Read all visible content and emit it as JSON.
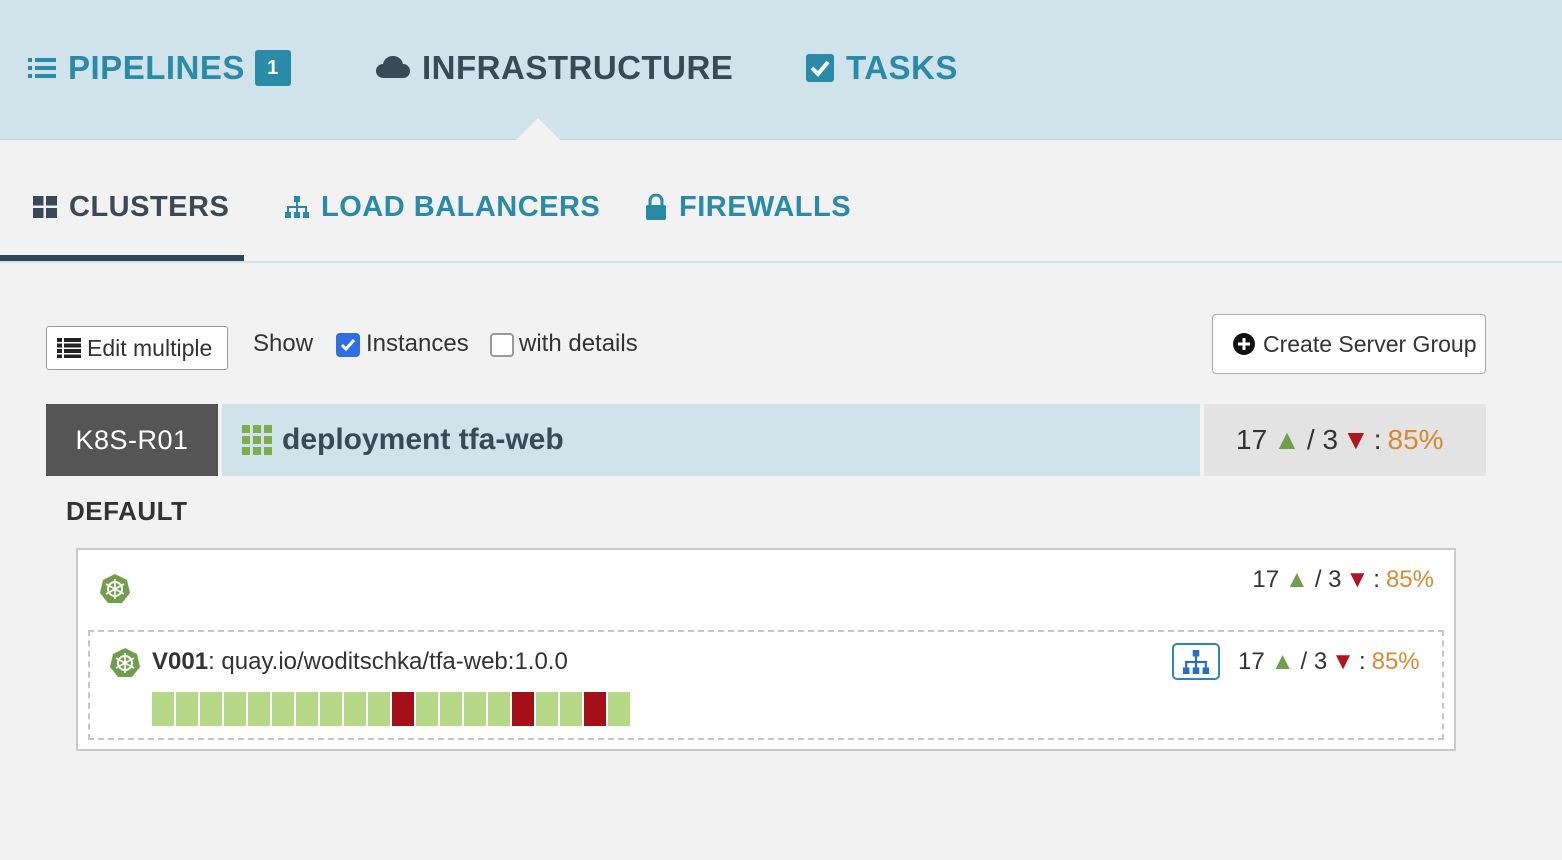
{
  "topnav": {
    "pipelines": {
      "label": "PIPELINES",
      "badge": "1"
    },
    "infrastructure": {
      "label": "INFRASTRUCTURE"
    },
    "tasks": {
      "label": "TASKS"
    }
  },
  "subtabs": {
    "clusters": "CLUSTERS",
    "load_balancers": "LOAD BALANCERS",
    "firewalls": "FIREWALLS"
  },
  "toolbar": {
    "edit_multiple": "Edit multiple",
    "show": "Show",
    "instances_label": "Instances",
    "instances_checked": true,
    "with_details_label": "with details",
    "with_details_checked": false,
    "create_server_group": "Create Server Group"
  },
  "cluster": {
    "account": "K8S-R01",
    "name": "deployment tfa-web",
    "health": {
      "up": "17",
      "sep": "/",
      "down": "3",
      "colon": ":",
      "pct": "85%"
    },
    "region": "DEFAULT",
    "region_health": {
      "up": "17",
      "sep": "/",
      "down": "3",
      "colon": ":",
      "pct": "85%"
    },
    "server_group": {
      "version": "V001",
      "image": ": quay.io/woditschka/tfa-web:1.0.0",
      "health": {
        "up": "17",
        "sep": "/",
        "down": "3",
        "colon": ":",
        "pct": "85%"
      },
      "instances": [
        "up",
        "up",
        "up",
        "up",
        "up",
        "up",
        "up",
        "up",
        "up",
        "up",
        "down",
        "up",
        "up",
        "up",
        "up",
        "down",
        "up",
        "up",
        "down",
        "up"
      ]
    }
  },
  "colors": {
    "accent": "#2a8ba8",
    "nav_bg": "#d0e2ea",
    "instance_up": "#b5d986",
    "instance_down": "#a51018",
    "health_up": "#6f9e4c",
    "health_down": "#b0141c",
    "health_pct": "#d68a32"
  }
}
